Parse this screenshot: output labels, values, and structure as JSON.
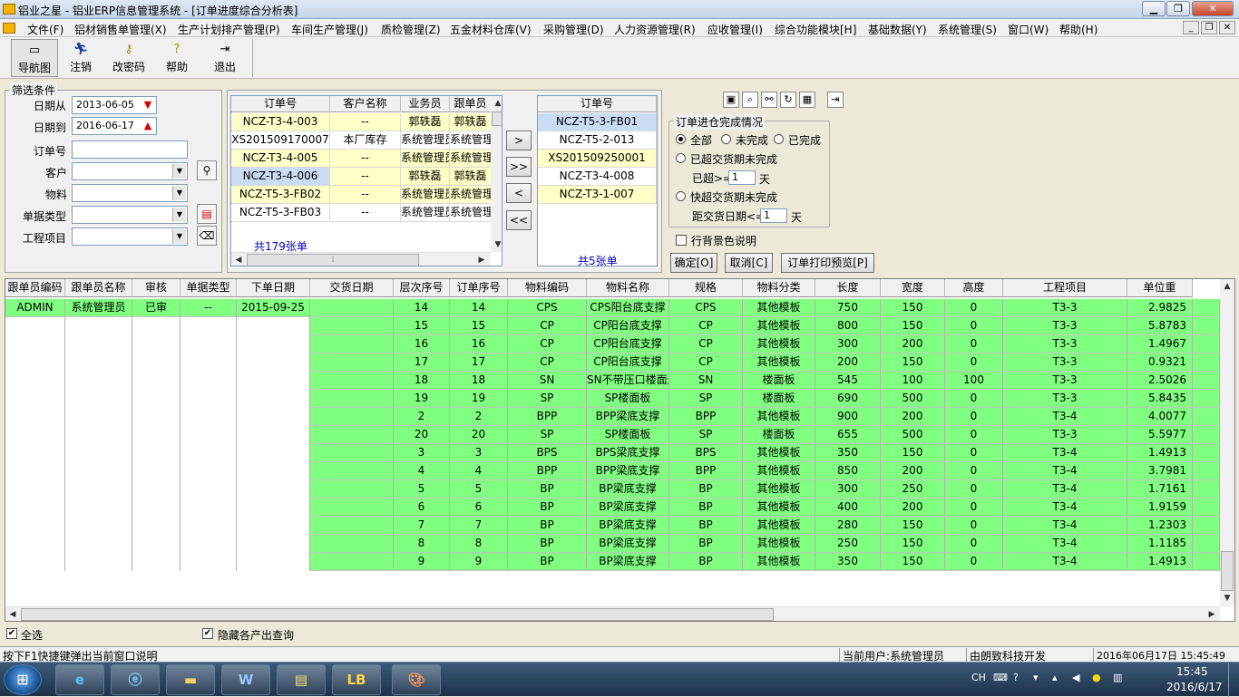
{
  "window": {
    "title": "铝业之星 - 铝业ERP信息管理系统 - [订单进度综合分析表]",
    "min": "▁",
    "max": "❐",
    "close": "✕"
  },
  "menu": [
    "文件(F)",
    "铝材销售单管理(X)",
    "生产计划排产管理(P)",
    "车间生产管理(J)",
    "质检管理(Z)",
    "五金材料仓库(V)",
    "采购管理(D)",
    "人力资源管理(R)",
    "应收管理(I)",
    "综合功能模块[H]",
    "基础数据(Y)",
    "系统管理(S)",
    "窗口(W)",
    "帮助(H)"
  ],
  "mdi_buttons": [
    "_",
    "❐",
    "✕"
  ],
  "toolbar": [
    {
      "label": "导航图",
      "icon": "navigation-map-icon"
    },
    {
      "label": "注销",
      "icon": "logout-runner-icon"
    },
    {
      "label": "改密码",
      "icon": "key-icon"
    },
    {
      "label": "帮助",
      "icon": "help-icon"
    },
    {
      "label": "退出",
      "icon": "exit-door-icon"
    }
  ],
  "filter": {
    "title": "筛选条件",
    "date_from_label": "日期从",
    "date_from": "2013-06-05",
    "date_to_label": "日期到",
    "date_to": "2016-06-17",
    "order_no_label": "订单号",
    "order_no": "",
    "customer_label": "客户",
    "customer": "",
    "material_label": "物料",
    "material": "",
    "doc_type_label": "单据类型",
    "doc_type": "",
    "project_label": "工程项目",
    "project": ""
  },
  "order_list": {
    "headers": [
      "订单号",
      "客户名称",
      "业务员",
      "跟单员"
    ],
    "rows": [
      [
        "NCZ-T3-4-003",
        "--",
        "郭轶磊",
        "郭轶磊"
      ],
      [
        "XS201509170007",
        "本厂库存",
        "系统管理员",
        "系统管理"
      ],
      [
        "NCZ-T3-4-005",
        "--",
        "系统管理员",
        "系统管理"
      ],
      [
        "NCZ-T3-4-006",
        "--",
        "郭轶磊",
        "郭轶磊"
      ],
      [
        "NCZ-T5-3-FB02",
        "--",
        "系统管理员",
        "系统管理"
      ],
      [
        "NCZ-T5-3-FB03",
        "--",
        "系统管理员",
        "系统管理"
      ]
    ],
    "count": "共179张单"
  },
  "move_buttons": [
    ">",
    ">>",
    "<",
    "<<"
  ],
  "selected_list": {
    "header": "订单号",
    "rows": [
      "NCZ-T5-3-FB01",
      "NCZ-T5-2-013",
      "XS201509250001",
      "NCZ-T3-4-008",
      "NCZ-T3-1-007"
    ],
    "count": "共5张单"
  },
  "status_group": {
    "title": "订单进仓完成情况",
    "all": "全部",
    "incomplete": "未完成",
    "complete": "已完成",
    "overdue": "已超交货期未完成",
    "overdue_label": "已超>=",
    "overdue_days": "1",
    "overdue_unit": "天",
    "near_due": "快超交货期未完成",
    "near_due_label": "距交货日期<=",
    "near_due_days": "1",
    "near_due_unit": "天"
  },
  "row_color_label": "行背景色说明",
  "buttons": {
    "ok": "确定[O]",
    "cancel": "取消[C]",
    "print_preview": "订单打印预览[P]"
  },
  "grid": {
    "headers": [
      "跟单员编码",
      "跟单员名称",
      "审核",
      "单据类型",
      "下单日期",
      "交货日期",
      "层次序号",
      "订单序号",
      "物料编码",
      "物料名称",
      "规格",
      "物料分类",
      "长度",
      "宽度",
      "高度",
      "工程项目",
      "单位重"
    ],
    "first_row": [
      "ADMIN",
      "系统管理员",
      "已审",
      "--",
      "2015-09-25"
    ],
    "rows": [
      [
        "14",
        "14",
        "CPS",
        "CPS阳台底支撑",
        "CPS",
        "其他模板",
        "750",
        "150",
        "0",
        "T3-3",
        "2.9825"
      ],
      [
        "15",
        "15",
        "CP",
        "CP阳台底支撑",
        "CP",
        "其他模板",
        "800",
        "150",
        "0",
        "T3-3",
        "5.8783"
      ],
      [
        "16",
        "16",
        "CP",
        "CP阳台底支撑",
        "CP",
        "其他模板",
        "300",
        "200",
        "0",
        "T3-3",
        "1.4967"
      ],
      [
        "17",
        "17",
        "CP",
        "CP阳台底支撑",
        "CP",
        "其他模板",
        "200",
        "150",
        "0",
        "T3-3",
        "0.9321"
      ],
      [
        "18",
        "18",
        "SN",
        "SN不带压口楼面连",
        "SN",
        "楼面板",
        "545",
        "100",
        "100",
        "T3-3",
        "2.5026"
      ],
      [
        "19",
        "19",
        "SP",
        "SP楼面板",
        "SP",
        "楼面板",
        "690",
        "500",
        "0",
        "T3-3",
        "5.8435"
      ],
      [
        "2",
        "2",
        "BPP",
        "BPP梁底支撑",
        "BPP",
        "其他模板",
        "900",
        "200",
        "0",
        "T3-4",
        "4.0077"
      ],
      [
        "20",
        "20",
        "SP",
        "SP楼面板",
        "SP",
        "楼面板",
        "655",
        "500",
        "0",
        "T3-3",
        "5.5977"
      ],
      [
        "3",
        "3",
        "BPS",
        "BPS梁底支撑",
        "BPS",
        "其他模板",
        "350",
        "150",
        "0",
        "T3-4",
        "1.4913"
      ],
      [
        "4",
        "4",
        "BPP",
        "BPP梁底支撑",
        "BPP",
        "其他模板",
        "850",
        "200",
        "0",
        "T3-4",
        "3.7981"
      ],
      [
        "5",
        "5",
        "BP",
        "BP梁底支撑",
        "BP",
        "其他模板",
        "300",
        "250",
        "0",
        "T3-4",
        "1.7161"
      ],
      [
        "6",
        "6",
        "BP",
        "BP梁底支撑",
        "BP",
        "其他模板",
        "400",
        "200",
        "0",
        "T3-4",
        "1.9159"
      ],
      [
        "7",
        "7",
        "BP",
        "BP梁底支撑",
        "BP",
        "其他模板",
        "280",
        "150",
        "0",
        "T3-4",
        "1.2303"
      ],
      [
        "8",
        "8",
        "BP",
        "BP梁底支撑",
        "BP",
        "其他模板",
        "250",
        "150",
        "0",
        "T3-4",
        "1.1185"
      ],
      [
        "9",
        "9",
        "BP",
        "BP梁底支撑",
        "BP",
        "其他模板",
        "350",
        "150",
        "0",
        "T3-4",
        "1.4913"
      ]
    ]
  },
  "select_all_label": "全选",
  "hide_label": "隐藏各产出查询",
  "status": {
    "hint": "按下F1快捷键弹出当前窗口说明",
    "user": "当前用户:系统管理员",
    "company": "由朗致科技开发",
    "datetime": "2016年06月17日 15:45:49"
  },
  "taskbar": {
    "apps": [
      "ie-icon",
      "ie-blue-icon",
      "folder-icon",
      "word-icon",
      "notepad-icon",
      "erp-app-icon",
      "paint-icon"
    ],
    "lang": "CH",
    "time": "15:45",
    "date": "2016/6/17"
  },
  "colors": {
    "row_green": "#80ff80",
    "row_yellow": "#ffffc8",
    "row_blue": "#c9dcf3"
  }
}
